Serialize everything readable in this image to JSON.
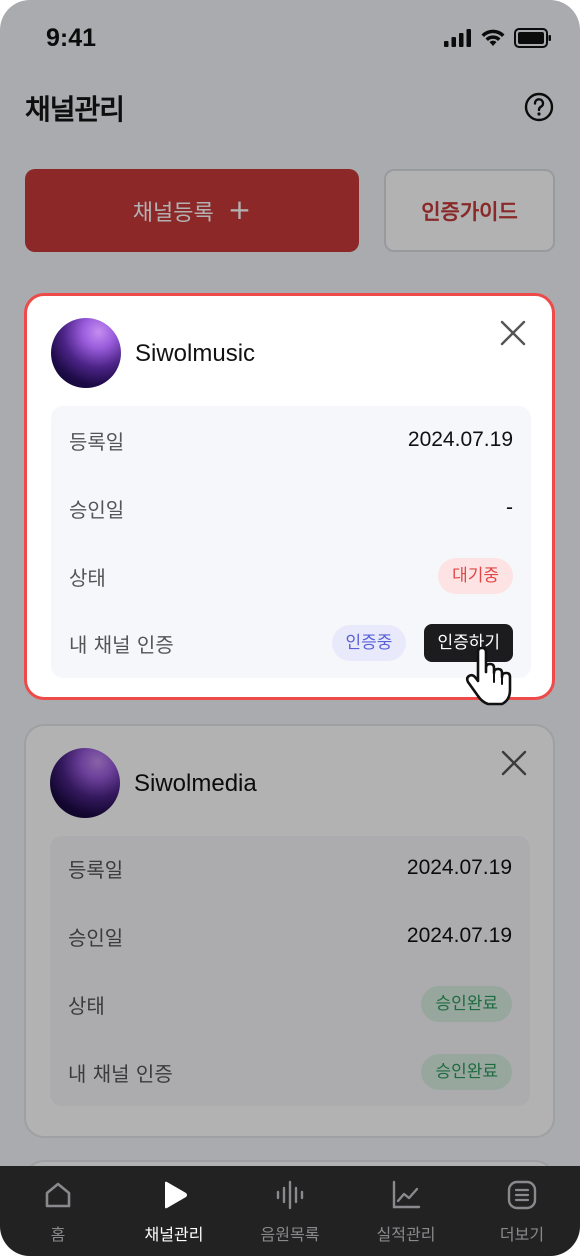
{
  "status_bar": {
    "time": "9:41"
  },
  "header": {
    "title": "채널관리"
  },
  "actions": {
    "register_label": "채널등록",
    "register_plus": "+",
    "guide_label": "인증가이드"
  },
  "channels": [
    {
      "name": "Siwolmusic",
      "rows": [
        {
          "label": "등록일",
          "value": "2024.07.19"
        },
        {
          "label": "승인일",
          "value": "-"
        },
        {
          "label": "상태",
          "badge": "대기중"
        },
        {
          "label": "내 채널 인증",
          "badge": "인증중",
          "button": "인증하기"
        }
      ]
    },
    {
      "name": "Siwolmedia",
      "rows": [
        {
          "label": "등록일",
          "value": "2024.07.19"
        },
        {
          "label": "승인일",
          "value": "2024.07.19"
        },
        {
          "label": "상태",
          "badge": "승인완료"
        },
        {
          "label": "내 채널 인증",
          "badge": "승인완료"
        }
      ]
    }
  ],
  "tabs": [
    {
      "label": "홈",
      "icon": "home-icon"
    },
    {
      "label": "채널관리",
      "icon": "play-icon",
      "active": true
    },
    {
      "label": "음원목록",
      "icon": "audio-wave-icon"
    },
    {
      "label": "실적관리",
      "icon": "chart-icon"
    },
    {
      "label": "더보기",
      "icon": "menu-icon"
    }
  ],
  "colors": {
    "accent": "#c93a3a",
    "highlight_border": "#ee4a4a",
    "tab_bar": "#222222"
  }
}
